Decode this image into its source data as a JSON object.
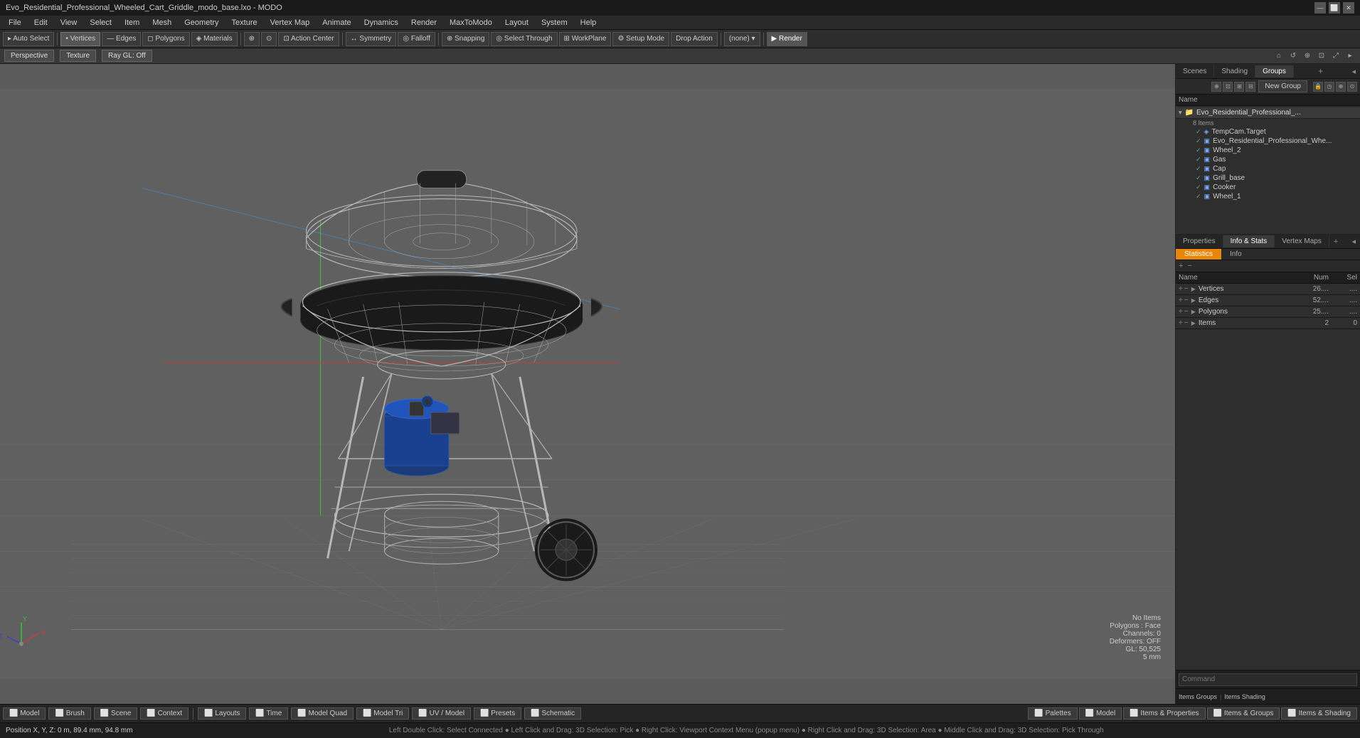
{
  "titlebar": {
    "title": "Evo_Residential_Professional_Wheeled_Cart_Griddle_modo_base.lxo - MODO",
    "controls": [
      "—",
      "⬜",
      "✕"
    ]
  },
  "menubar": {
    "items": [
      "File",
      "Edit",
      "View",
      "Select",
      "Item",
      "Mesh",
      "Geometry",
      "Texture",
      "Vertex Map",
      "Animate",
      "Dynamics",
      "Render",
      "MaxToModo",
      "Layout",
      "System",
      "Help"
    ]
  },
  "toolbar": {
    "items": [
      {
        "label": "Auto Select",
        "icon": "▸"
      },
      {
        "label": "Vertices",
        "icon": "•"
      },
      {
        "label": "Edges",
        "icon": "—"
      },
      {
        "label": "Polygons",
        "icon": "◻"
      },
      {
        "label": "Materials",
        "icon": "◈"
      },
      {
        "icon": "⊕"
      },
      {
        "icon": "⊙"
      },
      {
        "label": "Action Center",
        "icon": "⊡"
      },
      {
        "separator": true
      },
      {
        "label": "Symmetry"
      },
      {
        "label": "Falloff"
      },
      {
        "separator": true
      },
      {
        "label": "Snapping",
        "icon": "⊕"
      },
      {
        "label": "Select Through",
        "icon": "◎"
      },
      {
        "label": "WorkPlane"
      },
      {
        "label": "Setup Mode"
      },
      {
        "label": "Drop Action"
      },
      {
        "separator": true
      },
      {
        "label": "(none)",
        "dropdown": true
      },
      {
        "separator": true
      },
      {
        "label": "Render",
        "icon": "▶"
      }
    ]
  },
  "viewheader": {
    "perspective": "Perspective",
    "texture": "Texture",
    "raygl": "Ray GL: Off"
  },
  "rightpanel": {
    "top_tabs": [
      "Scenes",
      "Shading",
      "Groups"
    ],
    "active_top_tab": "Groups",
    "new_group_label": "New Group",
    "group_item": {
      "name": "Evo_Residential_Professional_Whe...",
      "count": "8 Items",
      "children": [
        "TempCam.Target",
        "Evo_Residential_Professional_Whe...",
        "Wheel_2",
        "Gas",
        "Cap",
        "Grill_base",
        "Cooker",
        "Wheel_1"
      ]
    }
  },
  "properties_panel": {
    "tabs": [
      "Properties",
      "Info & Stats",
      "Vertex Maps"
    ],
    "active_tab": "Info & Stats",
    "sub_tabs": [
      "Statistics",
      "Info"
    ],
    "active_sub": "Statistics",
    "columns": [
      "Name",
      "Num",
      "Sel"
    ],
    "rows": [
      {
        "name": "Vertices",
        "num": "26....",
        "sel": "...."
      },
      {
        "name": "Edges",
        "num": "52....",
        "sel": "...."
      },
      {
        "name": "Polygons",
        "num": "25....",
        "sel": "...."
      },
      {
        "name": "Items",
        "num": "2",
        "sel": "0"
      }
    ]
  },
  "viewport_info": {
    "no_items": "No Items",
    "polygons_face": "Polygons : Face",
    "channels": "Channels: 0",
    "deformers": "Deformers: OFF",
    "gl_info": "GL: 50,525",
    "size": "5 mm"
  },
  "command_bar": {
    "label": "Command",
    "placeholder": "Command"
  },
  "bottom_bar": {
    "left_items": [
      {
        "icon": "⬜",
        "label": "Model"
      },
      {
        "icon": "⬜",
        "label": "Brush"
      },
      {
        "icon": "⬜",
        "label": "Scene"
      },
      {
        "icon": "⬜",
        "label": "Context"
      }
    ],
    "center_items": [
      {
        "icon": "⬜",
        "label": "Layouts"
      },
      {
        "icon": "⬜",
        "label": "Time"
      },
      {
        "icon": "⬜",
        "label": "Model Quad"
      },
      {
        "icon": "⬜",
        "label": "Model Tri"
      },
      {
        "icon": "⬜",
        "label": "UV / Model"
      },
      {
        "icon": "⬜",
        "label": "Presets"
      },
      {
        "icon": "⬜",
        "label": "Schematic"
      }
    ],
    "right_items": [
      {
        "icon": "⬜",
        "label": "Palettes"
      },
      {
        "icon": "⬜",
        "label": "Model",
        "active": true
      },
      {
        "icon": "⬜",
        "label": "Items & Properties"
      },
      {
        "icon": "⬜",
        "label": "Items & Groups"
      },
      {
        "icon": "⬜",
        "label": "Items & Shading"
      }
    ]
  },
  "status_bar": {
    "position": "Position X, Y, Z:  0 m, 89.4 mm, 94.8 mm",
    "hint": "Left Double Click: Select Connected ● Left Click and Drag: 3D Selection: Pick ● Right Click: Viewport Context Menu (popup menu) ● Right Click and Drag: 3D Selection: Area ● Middle Click and Drag: 3D Selection: Pick Through"
  },
  "bottom_tabs_right": {
    "items_groups_label": "Items Groups",
    "items_shading_label": "Items Shading"
  }
}
